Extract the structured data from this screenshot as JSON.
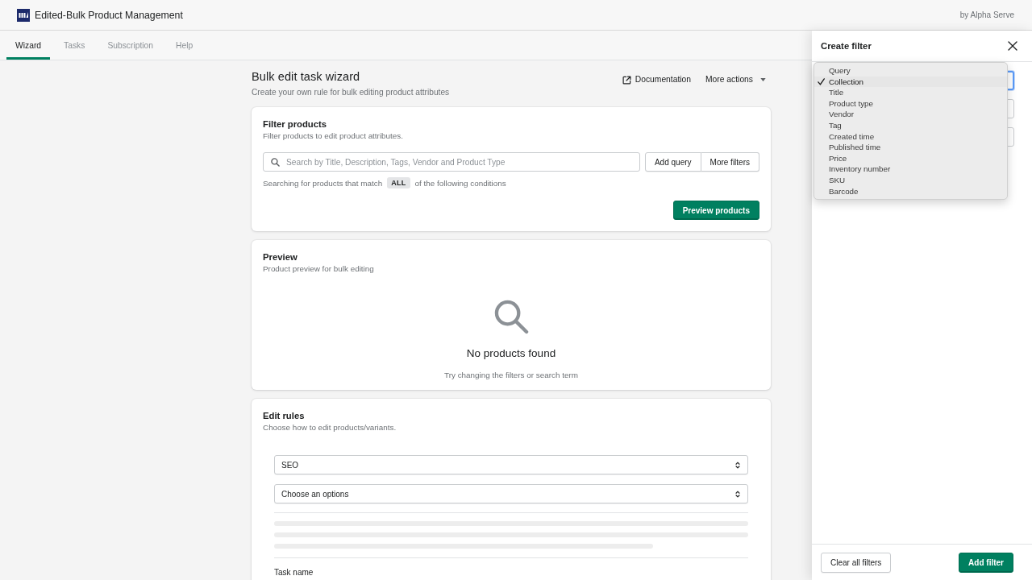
{
  "app_bar": {
    "title": "Edited-Bulk Product Management",
    "byline": "by Alpha Serve"
  },
  "tabs": [
    {
      "label": "Wizard",
      "selected": true
    },
    {
      "label": "Tasks",
      "selected": false
    },
    {
      "label": "Subscription",
      "selected": false
    },
    {
      "label": "Help",
      "selected": false
    }
  ],
  "page": {
    "title": "Bulk edit task wizard",
    "subtitle": "Create your own rule for bulk editing product attributes",
    "documentation_link": "Documentation",
    "more_actions": "More actions"
  },
  "filter_card": {
    "title": "Filter products",
    "subtitle": "Filter products to edit product attributes.",
    "search": {
      "placeholder": "Search by Title, Description, Tags, Vendor and Product Type"
    },
    "query_button": "Add query",
    "filters_button": "More filters",
    "match": {
      "before": "Searching for products that match",
      "badge": "ALL",
      "after": "of the following conditions"
    },
    "preview_button": "Preview products"
  },
  "preview_card": {
    "title": "Preview",
    "subtitle": "Product preview for bulk editing",
    "empty_heading": "No products found",
    "empty_hint": "Try changing the filters or search term"
  },
  "rules_card": {
    "title": "Edit rules",
    "subtitle": "Choose how to edit products/variants.",
    "selects": [
      {
        "value": "SEO"
      },
      {
        "value": "Choose an options"
      }
    ],
    "task_name_label": "Task name"
  },
  "filter_panel": {
    "title": "Create filter",
    "fields": [
      {
        "focused": true
      },
      {
        "focused": false
      },
      {
        "focused": false
      }
    ],
    "dropdown": {
      "options": [
        {
          "label": "Query",
          "selected": false
        },
        {
          "label": "Collection",
          "selected": true
        },
        {
          "label": "Title",
          "selected": false
        },
        {
          "label": "Product type",
          "selected": false
        },
        {
          "label": "Vendor",
          "selected": false
        },
        {
          "label": "Tag",
          "selected": false
        },
        {
          "label": "Created time",
          "selected": false
        },
        {
          "label": "Published time",
          "selected": false
        },
        {
          "label": "Price",
          "selected": false
        },
        {
          "label": "Inventory number",
          "selected": false
        },
        {
          "label": "SKU",
          "selected": false
        },
        {
          "label": "Barcode",
          "selected": false
        }
      ]
    },
    "clear_button": "Clear all filters",
    "submit_button": "Add filter"
  }
}
